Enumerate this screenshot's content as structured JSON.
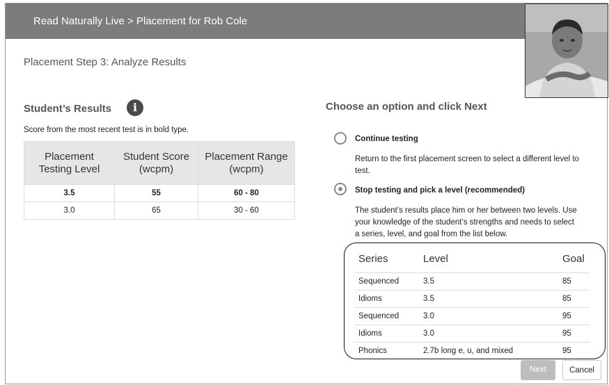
{
  "header": {
    "title": "Read Naturally Live > Placement for Rob Cole"
  },
  "student_photo": {
    "icon": "student-photo"
  },
  "step": {
    "title": "Placement Step 3: Analyze Results"
  },
  "results": {
    "heading": "Student’s Results",
    "info_icon": "i",
    "note": "Score from the most recent test is in bold type.",
    "columns": [
      "Placement Testing Level",
      "Student Score (wcpm)",
      "Placement Range (wcpm)"
    ],
    "column_lines": [
      [
        "Placement",
        "Testing Level"
      ],
      [
        "Student Score",
        "(wcpm)"
      ],
      [
        "Placement Range",
        "(wcpm)"
      ]
    ],
    "rows": [
      {
        "level": "3.5",
        "score": "55",
        "range": "60 - 80"
      },
      {
        "level": "3.0",
        "score": "65",
        "range": "30 - 60"
      }
    ]
  },
  "options": {
    "heading": "Choose an option and click Next",
    "continue": {
      "label": "Continue testing",
      "desc_line1": "Return to the first placement screen to select a different level to",
      "desc_line2": "test.",
      "selected": false
    },
    "stop": {
      "label": "Stop testing and pick a level (recommended)",
      "desc_line1": "The student’s results place him or her between two levels. Use",
      "desc_line2": "your knowledge of the student’s strengths and needs to select",
      "desc_line3": "a series, level, and goal from the list below.",
      "selected": true
    }
  },
  "series_list": {
    "columns": [
      "Series",
      "Level",
      "Goal"
    ],
    "rows": [
      {
        "series": "Sequenced",
        "level": "3.5",
        "goal": "85"
      },
      {
        "series": "Idioms",
        "level": "3.5",
        "goal": "85"
      },
      {
        "series": "Sequenced",
        "level": "3.0",
        "goal": "95"
      },
      {
        "series": "Idioms",
        "level": "3.0",
        "goal": "95"
      },
      {
        "series": "Phonics",
        "level": "2.7b long e, u, and mixed",
        "goal": "95"
      }
    ]
  },
  "buttons": {
    "next": "Next",
    "cancel": "Cancel"
  }
}
